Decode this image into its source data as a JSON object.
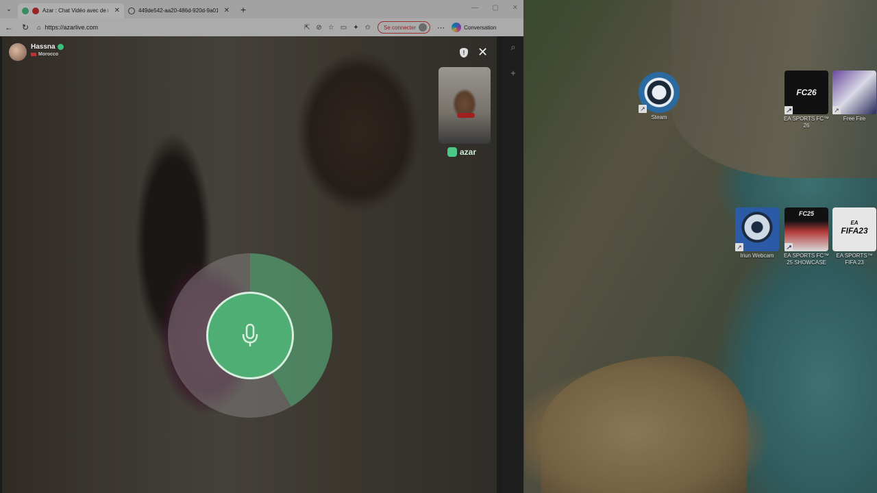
{
  "browser": {
    "tabs": [
      {
        "title": "Azar : Chat Vidéo avec de no",
        "active": true
      },
      {
        "title": "449de542-aa20-486d-920d-9a01",
        "active": false
      }
    ],
    "url": "https://azarlive.com",
    "signin_label": "Se connecter",
    "conversation_label": "Conversation"
  },
  "video_chat": {
    "peer_name": "Hassna",
    "peer_country": "Morocco",
    "brand": "azar"
  },
  "desktop_icons": [
    {
      "label": "Steam"
    },
    {
      "label": "EA SPORTS FC™ 26"
    },
    {
      "label": "Free Fire"
    },
    {
      "label": "Iriun Webcam"
    },
    {
      "label": "EA SPORTS FC™ 25 SHOWCASE"
    },
    {
      "label": "EA SPORTS™ FIFA 23"
    }
  ],
  "tile_text": {
    "fc26": "FC26",
    "fc25": "FC25",
    "fifa23": "FIFA23",
    "ea": "EA"
  },
  "colors": {
    "accent_green": "#4fae74",
    "signin_red": "#d44444"
  }
}
